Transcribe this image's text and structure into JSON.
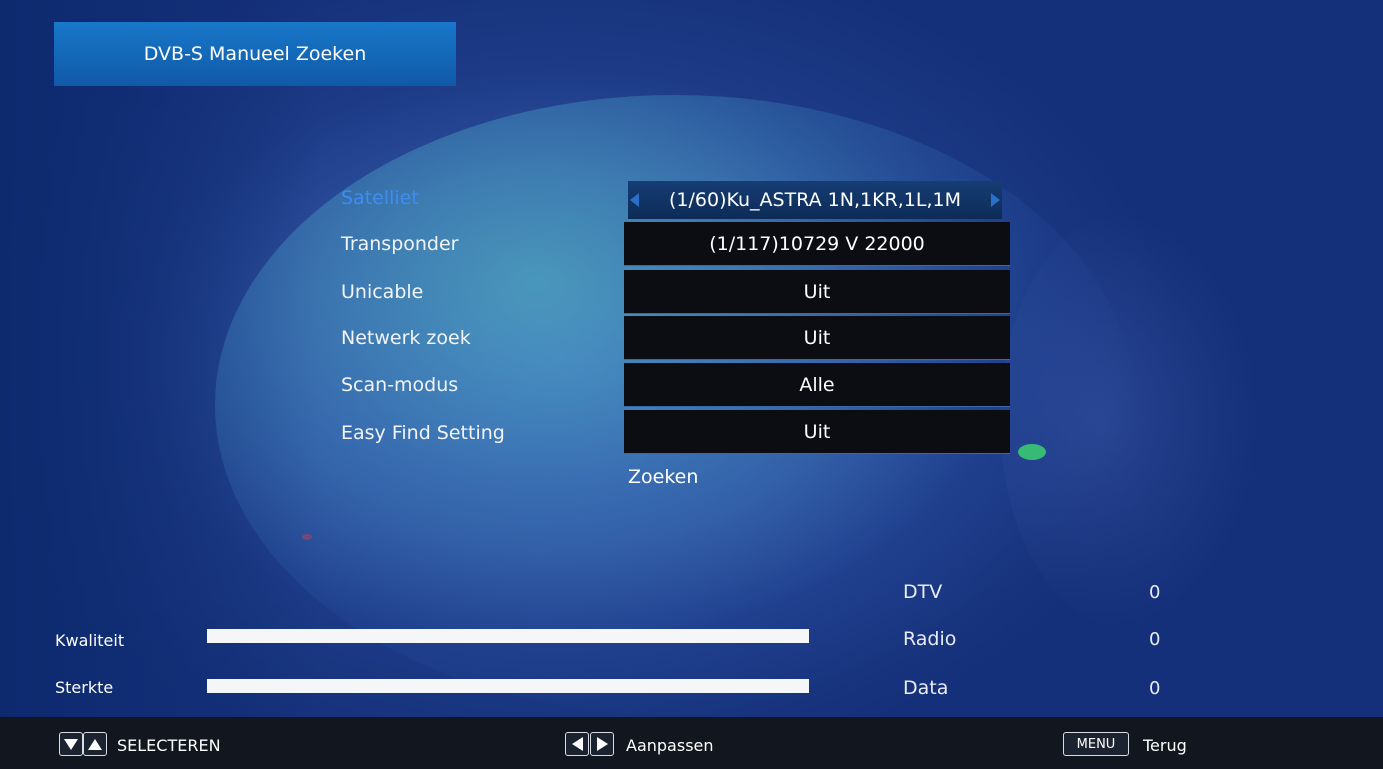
{
  "title": "DVB-S Manueel Zoeken",
  "settings": [
    {
      "label": "Satelliet",
      "value": "(1/60)Ku_ASTRA 1N,1KR,1L,1M"
    },
    {
      "label": "Transponder",
      "value": "(1/117)10729 V 22000"
    },
    {
      "label": "Unicable",
      "value": "Uit"
    },
    {
      "label": "Netwerk zoek",
      "value": "Uit"
    },
    {
      "label": "Scan-modus",
      "value": "Alle"
    },
    {
      "label": "Easy Find Setting",
      "value": "Uit"
    }
  ],
  "search_label": "Zoeken",
  "meters": {
    "quality": {
      "label": "Kwaliteit",
      "level_percent": 100
    },
    "strength": {
      "label": "Sterkte",
      "level_percent": 100
    }
  },
  "counts": [
    {
      "label": "DTV",
      "value": "0"
    },
    {
      "label": "Radio",
      "value": "0"
    },
    {
      "label": "Data",
      "value": "0"
    }
  ],
  "footer": {
    "select_label": "SELECTEREN",
    "adjust_label": "Aanpassen",
    "menu_key": "MENU",
    "back_label": "Terug"
  },
  "colors": {
    "active_label": "#3f8df0",
    "title_bg": "#1977c9",
    "value_bg": "#0b0d12"
  }
}
